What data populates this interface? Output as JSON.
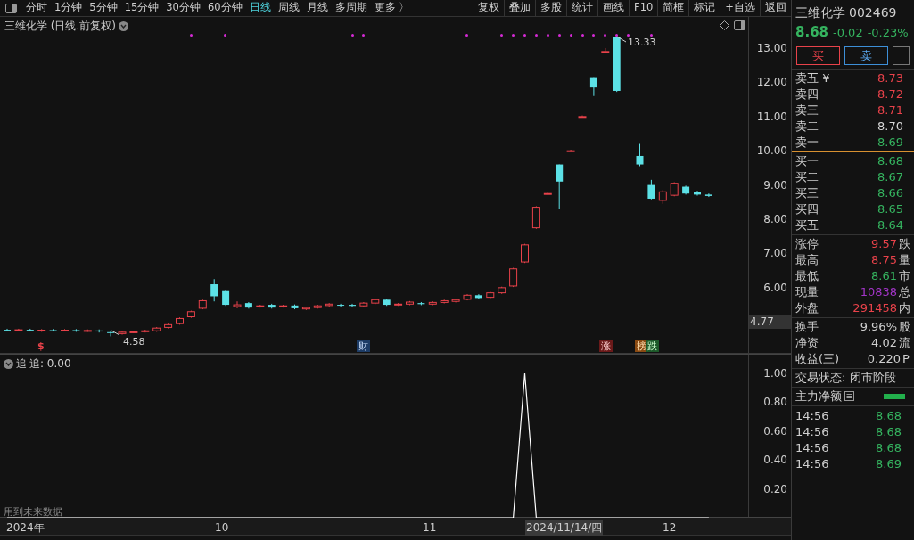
{
  "toolbar": {
    "period_tabs": [
      {
        "label": "分时",
        "selected": false
      },
      {
        "label": "1分钟",
        "selected": false
      },
      {
        "label": "5分钟",
        "selected": false
      },
      {
        "label": "15分钟",
        "selected": false
      },
      {
        "label": "30分钟",
        "selected": false
      },
      {
        "label": "60分钟",
        "selected": false
      },
      {
        "label": "日线",
        "selected": true
      },
      {
        "label": "周线",
        "selected": false
      },
      {
        "label": "月线",
        "selected": false
      },
      {
        "label": "多周期",
        "selected": false
      },
      {
        "label": "更多 〉",
        "selected": false
      }
    ],
    "actions": [
      "复权",
      "叠加",
      "多股",
      "统计",
      "画线",
      "F10",
      "简框",
      "标记",
      "+自选",
      "返回"
    ]
  },
  "main_chart": {
    "title": "三维化学 (日线.前复权)",
    "last_price_tag": "4.77",
    "high_label": "13.33",
    "low_label": "4.58",
    "chart_data": {
      "type": "candlestick",
      "ylim": [
        4.07,
        13.91
      ],
      "yticks": [
        {
          "value": 13,
          "label": "13.00"
        },
        {
          "value": 12,
          "label": "12.00"
        },
        {
          "value": 11,
          "label": "11.00"
        },
        {
          "value": 10,
          "label": "10.00"
        },
        {
          "value": 9,
          "label": "9.00"
        },
        {
          "value": 8,
          "label": "8.00"
        },
        {
          "value": 7,
          "label": "7.00"
        },
        {
          "value": 6,
          "label": "6.00"
        }
      ],
      "categories": [
        null,
        null,
        null,
        null,
        null,
        null,
        null,
        null,
        null,
        null,
        null,
        null,
        null,
        null,
        null,
        null,
        null,
        null,
        null,
        null,
        null,
        null,
        null,
        null,
        null,
        null,
        null,
        null,
        null,
        null,
        null,
        null,
        null,
        null,
        null,
        null,
        null,
        null,
        null,
        null,
        null,
        null,
        null,
        null,
        null,
        null,
        null,
        null,
        null,
        null,
        null,
        null,
        null,
        null,
        null,
        null,
        null,
        null,
        null,
        null,
        null,
        null
      ],
      "ohlc": [
        [
          4.77,
          4.8,
          4.73,
          4.76
        ],
        [
          4.75,
          4.8,
          4.72,
          4.77
        ],
        [
          4.77,
          4.8,
          4.72,
          4.75
        ],
        [
          4.74,
          4.79,
          4.71,
          4.76
        ],
        [
          4.76,
          4.79,
          4.72,
          4.75
        ],
        [
          4.75,
          4.79,
          4.72,
          4.76
        ],
        [
          4.76,
          4.79,
          4.71,
          4.74
        ],
        [
          4.74,
          4.78,
          4.71,
          4.75
        ],
        [
          4.75,
          4.78,
          4.69,
          4.72
        ],
        [
          4.7,
          4.72,
          4.58,
          4.68
        ],
        [
          4.66,
          4.73,
          4.63,
          4.7
        ],
        [
          4.7,
          4.74,
          4.67,
          4.71
        ],
        [
          4.72,
          4.77,
          4.69,
          4.74
        ],
        [
          4.74,
          4.85,
          4.71,
          4.82
        ],
        [
          4.84,
          4.95,
          4.81,
          4.92
        ],
        [
          4.95,
          5.13,
          4.92,
          5.1
        ],
        [
          5.15,
          5.33,
          5.12,
          5.3
        ],
        [
          5.4,
          5.65,
          5.37,
          5.62
        ],
        [
          6.1,
          6.25,
          5.6,
          5.75
        ],
        [
          5.9,
          5.93,
          5.47,
          5.5
        ],
        [
          5.45,
          5.6,
          5.4,
          5.5
        ],
        [
          5.55,
          5.58,
          5.39,
          5.42
        ],
        [
          5.45,
          5.5,
          5.42,
          5.47
        ],
        [
          5.5,
          5.53,
          5.39,
          5.42
        ],
        [
          5.45,
          5.5,
          5.42,
          5.47
        ],
        [
          5.48,
          5.51,
          5.37,
          5.4
        ],
        [
          5.38,
          5.45,
          5.35,
          5.42
        ],
        [
          5.42,
          5.5,
          5.39,
          5.47
        ],
        [
          5.48,
          5.55,
          5.45,
          5.52
        ],
        [
          5.5,
          5.53,
          5.45,
          5.48
        ],
        [
          5.5,
          5.53,
          5.44,
          5.47
        ],
        [
          5.47,
          5.58,
          5.44,
          5.55
        ],
        [
          5.55,
          5.68,
          5.52,
          5.65
        ],
        [
          5.65,
          5.68,
          5.47,
          5.5
        ],
        [
          5.5,
          5.55,
          5.47,
          5.52
        ],
        [
          5.52,
          5.61,
          5.49,
          5.58
        ],
        [
          5.55,
          5.58,
          5.49,
          5.52
        ],
        [
          5.52,
          5.6,
          5.49,
          5.57
        ],
        [
          5.57,
          5.65,
          5.54,
          5.62
        ],
        [
          5.6,
          5.68,
          5.57,
          5.65
        ],
        [
          5.66,
          5.81,
          5.63,
          5.78
        ],
        [
          5.78,
          5.81,
          5.67,
          5.7
        ],
        [
          5.72,
          5.88,
          5.69,
          5.85
        ],
        [
          5.85,
          6.03,
          5.82,
          6.0
        ],
        [
          6.05,
          6.58,
          6.02,
          6.55
        ],
        [
          6.75,
          7.28,
          6.72,
          7.25
        ],
        [
          7.75,
          8.38,
          7.72,
          8.35
        ],
        [
          8.75,
          8.78,
          8.72,
          8.75
        ],
        [
          9.6,
          9.6,
          8.3,
          9.1
        ],
        [
          10.0,
          10.03,
          9.97,
          10.0
        ],
        [
          11.0,
          11.03,
          10.97,
          11.0
        ],
        [
          12.15,
          12.15,
          11.6,
          11.85
        ],
        [
          12.9,
          13.0,
          12.9,
          12.9
        ],
        [
          13.33,
          13.33,
          11.72,
          11.75
        ],
        null,
        [
          9.85,
          10.2,
          9.55,
          9.6
        ],
        [
          9.0,
          9.15,
          8.58,
          8.6
        ],
        [
          8.55,
          8.85,
          8.45,
          8.8
        ],
        [
          8.7,
          9.08,
          8.67,
          9.05
        ],
        [
          8.95,
          8.98,
          8.72,
          8.75
        ],
        [
          8.8,
          8.83,
          8.69,
          8.72
        ],
        [
          8.72,
          8.75,
          8.65,
          8.68
        ]
      ]
    },
    "markers": [
      {
        "label": "$",
        "kind": "dollar"
      },
      {
        "label": "财",
        "kind": "finance"
      },
      {
        "label": "涨",
        "kind": "rise"
      },
      {
        "label": "榜",
        "kind": "list"
      },
      {
        "label": "跌",
        "kind": "fall"
      }
    ]
  },
  "indicator": {
    "name": "追",
    "reading": "追: 0.00",
    "note": "用到未来数据",
    "chart_data": {
      "type": "line",
      "ylim": [
        0,
        1.13
      ],
      "categories": [
        null,
        null,
        null,
        null,
        null,
        null,
        null,
        null,
        null,
        null,
        null,
        null,
        null,
        null,
        null,
        null,
        null,
        null,
        null,
        null,
        null,
        null,
        null,
        null,
        null,
        null,
        null,
        null,
        null,
        null,
        null,
        null,
        null,
        null,
        null,
        null,
        null,
        null,
        null,
        null,
        null,
        null,
        null,
        null,
        null,
        null,
        null,
        null,
        null,
        null,
        null,
        null,
        null,
        null,
        null,
        null,
        null,
        null,
        null,
        null,
        null,
        null
      ],
      "yticks": [
        {
          "value": 0.2,
          "label": "0.20"
        },
        {
          "value": 0.4,
          "label": "0.40"
        },
        {
          "value": 0.6,
          "label": "0.60"
        },
        {
          "value": 0.8,
          "label": "0.80"
        },
        {
          "value": 1,
          "label": "1.00"
        }
      ],
      "series": [
        {
          "color": "#ffffff",
          "values": [
            0,
            0,
            0,
            0,
            0,
            0,
            0,
            0,
            0,
            0,
            0,
            0,
            0,
            0,
            0,
            0,
            0,
            0,
            0,
            0,
            0,
            0,
            0,
            0,
            0,
            0,
            0,
            0,
            0,
            0,
            0,
            0,
            0,
            0,
            0,
            0,
            0,
            0,
            0,
            0,
            0,
            0,
            0,
            0,
            0,
            1,
            0,
            0,
            0,
            0,
            0,
            0,
            0,
            0,
            0,
            0,
            0,
            0,
            0,
            0,
            0,
            0
          ]
        }
      ]
    }
  },
  "date_axis": [
    {
      "label": "2024年",
      "cursor": false
    },
    {
      "label": "10",
      "cursor": false
    },
    {
      "label": "11",
      "cursor": false
    },
    {
      "label": "2024/11/14/四",
      "cursor": true
    },
    {
      "label": "12",
      "cursor": false
    }
  ],
  "quote": {
    "name": "三维化学",
    "code": "002469",
    "price": "8.68",
    "change": "-0.02",
    "percent": "-0.23%",
    "buttons": [
      {
        "label": "买",
        "kind": "buy"
      },
      {
        "label": "卖",
        "kind": "sell"
      }
    ],
    "asks": [
      {
        "label": "卖五 ¥",
        "value": "8.73",
        "color": "#e8424a"
      },
      {
        "label": "卖四",
        "value": "8.72",
        "color": "#e8424a"
      },
      {
        "label": "卖三",
        "value": "8.71",
        "color": "#e8424a"
      },
      {
        "label": "卖二",
        "value": "8.70",
        "color": "#d8d8d8"
      },
      {
        "label": "卖一",
        "value": "8.69",
        "color": "#35b35f"
      }
    ],
    "bids": [
      {
        "label": "买一",
        "value": "8.68",
        "color": "#35b35f"
      },
      {
        "label": "买二",
        "value": "8.67",
        "color": "#35b35f"
      },
      {
        "label": "买三",
        "value": "8.66",
        "color": "#35b35f"
      },
      {
        "label": "买四",
        "value": "8.65",
        "color": "#35b35f"
      },
      {
        "label": "买五",
        "value": "8.64",
        "color": "#35b35f"
      }
    ],
    "stats": [
      {
        "label": "涨停",
        "value": "9.57",
        "color": "#e8424a",
        "side": "跌"
      },
      {
        "label": "最高",
        "value": "8.75",
        "color": "#e8424a",
        "side": "量"
      },
      {
        "label": "最低",
        "value": "8.61",
        "color": "#35b35f",
        "side": "市"
      },
      {
        "label": "现量",
        "value": "10838",
        "color": "#a335c8",
        "side": "总"
      },
      {
        "label": "外盘",
        "value": "291458",
        "color": "#e8424a",
        "side": "内"
      }
    ],
    "fundamentals": [
      {
        "label": "换手",
        "value": "9.96%",
        "side": "股"
      },
      {
        "label": "净资",
        "value": "4.02",
        "side": "流"
      },
      {
        "label": "收益(三)",
        "value": "0.220",
        "side": "P"
      }
    ],
    "status": "交易状态: 闭市阶段",
    "main_force": "主力净额",
    "ticks": [
      {
        "time": "14:56",
        "price": "8.68"
      },
      {
        "time": "14:56",
        "price": "8.68"
      },
      {
        "time": "14:56",
        "price": "8.68"
      },
      {
        "time": "14:56",
        "price": "8.69"
      }
    ]
  }
}
